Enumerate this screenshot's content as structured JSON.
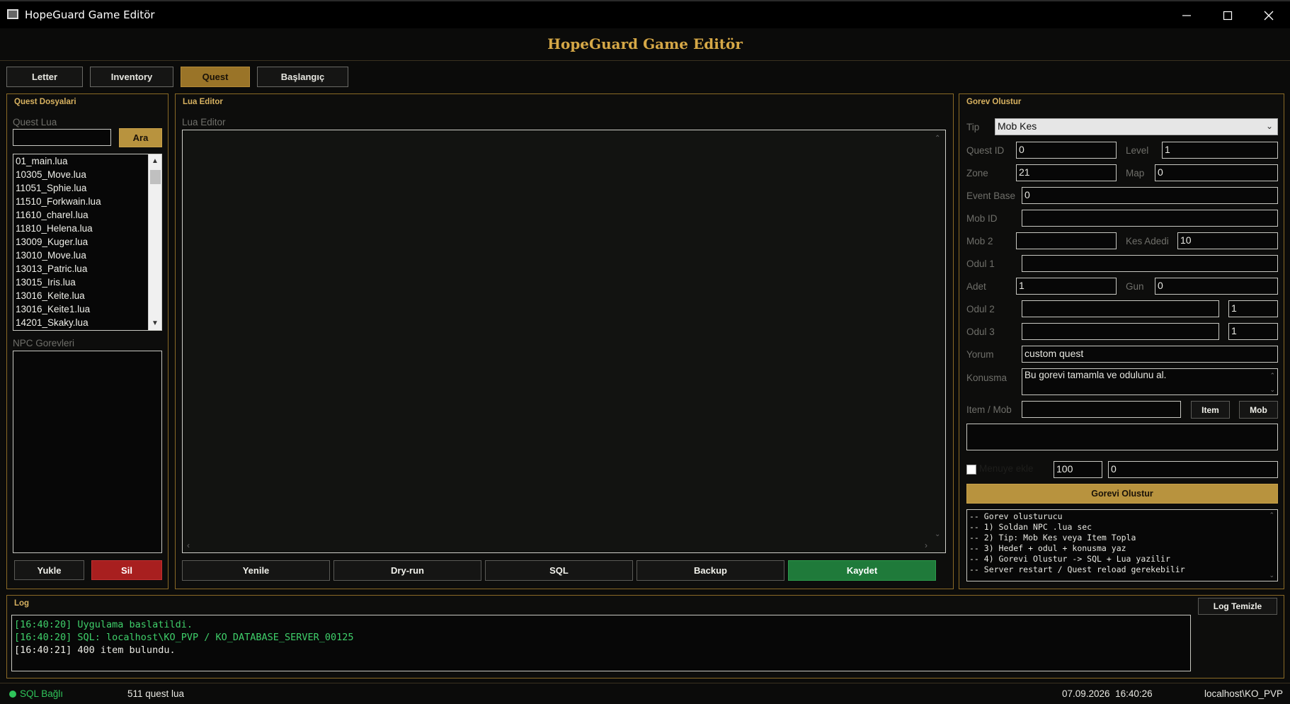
{
  "window": {
    "title": "HopeGuard Game Editör"
  },
  "header": {
    "title": "HopeGuard Game Editör"
  },
  "tabs": [
    {
      "label": "Letter"
    },
    {
      "label": "Inventory"
    },
    {
      "label": "Quest"
    },
    {
      "label": "Başlangıç"
    }
  ],
  "left_panel": {
    "title": "Quest Dosyalari",
    "search_label": "Quest Lua",
    "search_value": "",
    "search_button": "Ara",
    "files": [
      "01_main.lua",
      "10305_Move.lua",
      "11051_Sphie.lua",
      "11510_Forkwain.lua",
      "11610_charel.lua",
      "11810_Helena.lua",
      "13009_Kuger.lua",
      "13010_Move.lua",
      "13013_Patric.lua",
      "13015_Iris.lua",
      "13016_Keite.lua",
      "13016_Keite1.lua",
      "14201_Skaky.lua"
    ],
    "npc_label": "NPC Gorevleri",
    "load_button": "Yukle",
    "delete_button": "Sil"
  },
  "editor": {
    "title": "Lua Editor",
    "label": "Lua Editor",
    "buttons": {
      "refresh": "Yenile",
      "dryrun": "Dry-run",
      "sql": "SQL",
      "backup": "Backup",
      "save": "Kaydet"
    }
  },
  "quest_form": {
    "title": "Gorev Olustur",
    "tip_label": "Tip",
    "tip_value": "Mob Kes",
    "quest_id_label": "Quest ID",
    "quest_id": "0",
    "level_label": "Level",
    "level": "1",
    "zone_label": "Zone",
    "zone": "21",
    "map_label": "Map",
    "map": "0",
    "event_base_label": "Event Base",
    "event_base": "0",
    "mob_id_label": "Mob ID",
    "mob_id": "",
    "mob2_label": "Mob 2",
    "mob2": "",
    "kes_adedi_label": "Kes Adedi",
    "kes_adedi": "10",
    "odul1_label": "Odul 1",
    "odul1": "",
    "adet_label": "Adet",
    "adet": "1",
    "gun_label": "Gun",
    "gun": "0",
    "odul2_label": "Odul 2",
    "odul2": "",
    "odul2_qty": "1",
    "odul3_label": "Odul 3",
    "odul3": "",
    "odul3_qty": "1",
    "yorum_label": "Yorum",
    "yorum": "custom quest",
    "konusma_label": "Konusma",
    "konusma": "Bu gorevi tamamla ve odulunu al.",
    "item_mob_label": "Item / Mob",
    "item_mob": "",
    "item_button": "Item",
    "mob_button": "Mob",
    "menu_checkbox_label": "Menuye ekle",
    "menu_value1": "100",
    "menu_value2": "0",
    "create_button": "Gorevi Olustur",
    "help_lines": [
      "-- Gorev olusturucu",
      "-- 1) Soldan NPC .lua sec",
      "-- 2) Tip: Mob Kes veya Item Topla",
      "-- 3) Hedef + odul + konusma yaz",
      "-- 4) Gorevi Olustur -> SQL + Lua yazilir",
      "-- Server restart / Quest reload gerekebilir"
    ]
  },
  "log": {
    "title": "Log",
    "clear_button": "Log Temizle",
    "lines": [
      {
        "text": "[16:40:20] Uygulama baslatildi.",
        "color": "#3fcf6a"
      },
      {
        "text": "[16:40:20] SQL: localhost\\KO_PVP / KO_DATABASE_SERVER_00125",
        "color": "#3fcf6a"
      },
      {
        "text": "[16:40:21] 400 item bulundu.",
        "color": "#e8e8e2"
      }
    ]
  },
  "status": {
    "sql": "SQL Bağlı",
    "count": "511 quest lua",
    "datetime": "07.09.2026  16:40:26",
    "server": "localhost\\KO_PVP",
    "accent": "#d6a847",
    "connected_color": "#2fc45a"
  }
}
